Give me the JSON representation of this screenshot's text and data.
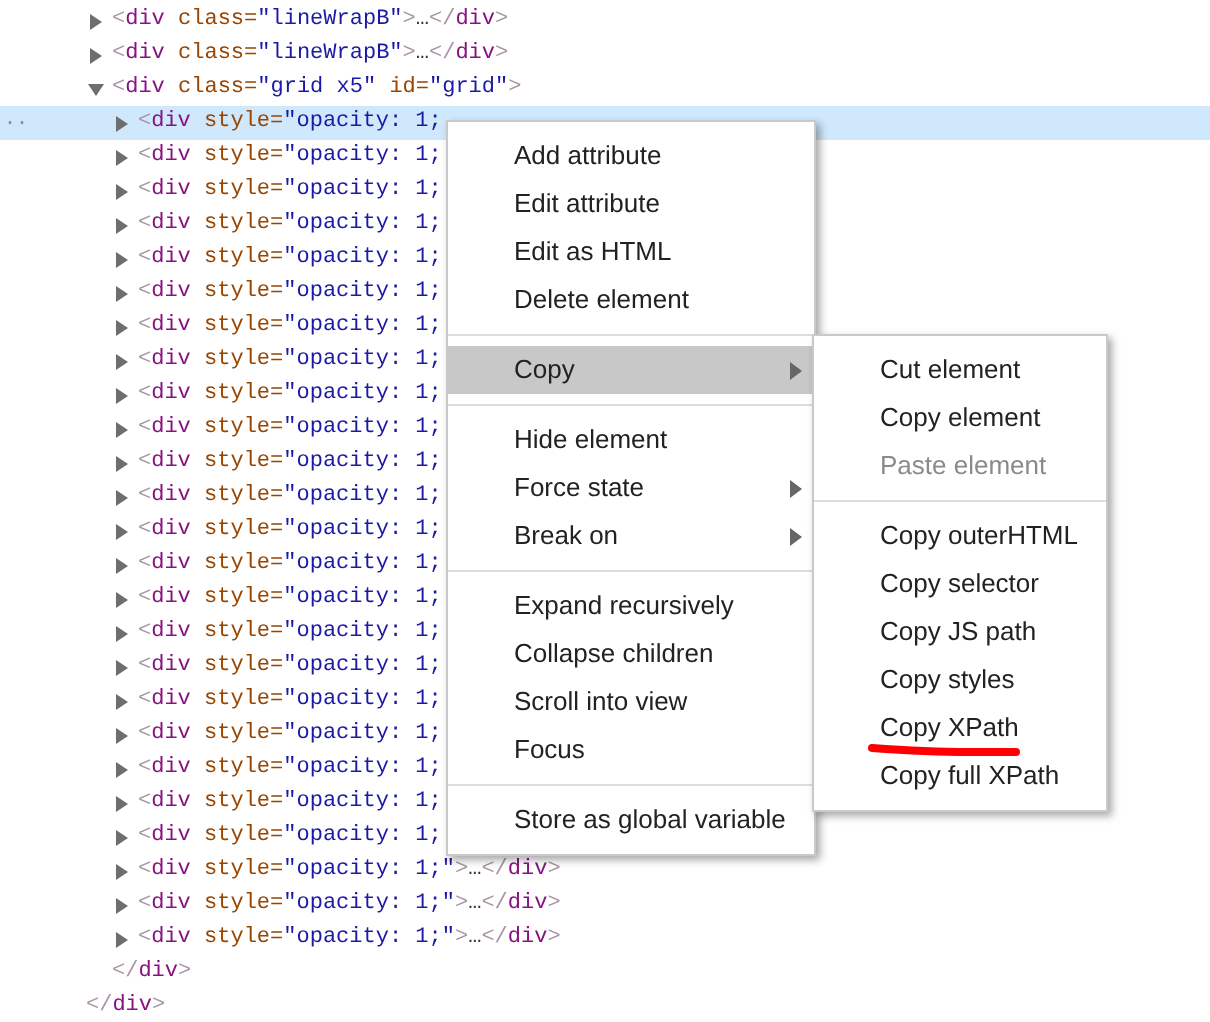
{
  "elements_panel": {
    "nodes": [
      {
        "expanded": false,
        "selected": false,
        "open": "<",
        "tag": "div",
        "attrs": [
          {
            "name": "class",
            "eq": "=",
            "value": "\"lineWrapB\""
          }
        ],
        "close": ">",
        "ellipsis": "…",
        "end_open": "</",
        "end_tag": "div",
        "end_close": ">"
      },
      {
        "expanded": false,
        "selected": false,
        "open": "<",
        "tag": "div",
        "attrs": [
          {
            "name": "class",
            "eq": "=",
            "value": "\"lineWrapB\""
          }
        ],
        "close": ">",
        "ellipsis": "…",
        "end_open": "</",
        "end_tag": "div",
        "end_close": ">"
      },
      {
        "expanded": true,
        "selected": false,
        "open": "<",
        "tag": "div",
        "attrs": [
          {
            "name": "class",
            "eq": "=",
            "value": "\"grid x5\""
          },
          {
            "name": "id",
            "eq": "=",
            "value": "\"grid\""
          }
        ],
        "close": ">",
        "children": [
          {
            "expanded": false,
            "selected": true,
            "lead": "..",
            "open": "<",
            "tag": "div",
            "attrs": [
              {
                "name": "style",
                "eq": "=",
                "value": "\"opacity: 1;"
              }
            ]
          },
          {
            "expanded": false,
            "selected": false,
            "open": "<",
            "tag": "div",
            "attrs": [
              {
                "name": "style",
                "eq": "=",
                "value": "\"opacity: 1;"
              }
            ]
          },
          {
            "expanded": false,
            "selected": false,
            "open": "<",
            "tag": "div",
            "attrs": [
              {
                "name": "style",
                "eq": "=",
                "value": "\"opacity: 1;"
              }
            ]
          },
          {
            "expanded": false,
            "selected": false,
            "open": "<",
            "tag": "div",
            "attrs": [
              {
                "name": "style",
                "eq": "=",
                "value": "\"opacity: 1;"
              }
            ]
          },
          {
            "expanded": false,
            "selected": false,
            "open": "<",
            "tag": "div",
            "attrs": [
              {
                "name": "style",
                "eq": "=",
                "value": "\"opacity: 1;"
              }
            ]
          },
          {
            "expanded": false,
            "selected": false,
            "open": "<",
            "tag": "div",
            "attrs": [
              {
                "name": "style",
                "eq": "=",
                "value": "\"opacity: 1;"
              }
            ]
          },
          {
            "expanded": false,
            "selected": false,
            "open": "<",
            "tag": "div",
            "attrs": [
              {
                "name": "style",
                "eq": "=",
                "value": "\"opacity: 1;"
              }
            ]
          },
          {
            "expanded": false,
            "selected": false,
            "open": "<",
            "tag": "div",
            "attrs": [
              {
                "name": "style",
                "eq": "=",
                "value": "\"opacity: 1;"
              }
            ]
          },
          {
            "expanded": false,
            "selected": false,
            "open": "<",
            "tag": "div",
            "attrs": [
              {
                "name": "style",
                "eq": "=",
                "value": "\"opacity: 1;"
              }
            ]
          },
          {
            "expanded": false,
            "selected": false,
            "open": "<",
            "tag": "div",
            "attrs": [
              {
                "name": "style",
                "eq": "=",
                "value": "\"opacity: 1;"
              }
            ]
          },
          {
            "expanded": false,
            "selected": false,
            "open": "<",
            "tag": "div",
            "attrs": [
              {
                "name": "style",
                "eq": "=",
                "value": "\"opacity: 1;"
              }
            ]
          },
          {
            "expanded": false,
            "selected": false,
            "open": "<",
            "tag": "div",
            "attrs": [
              {
                "name": "style",
                "eq": "=",
                "value": "\"opacity: 1;"
              }
            ]
          },
          {
            "expanded": false,
            "selected": false,
            "open": "<",
            "tag": "div",
            "attrs": [
              {
                "name": "style",
                "eq": "=",
                "value": "\"opacity: 1;"
              }
            ]
          },
          {
            "expanded": false,
            "selected": false,
            "open": "<",
            "tag": "div",
            "attrs": [
              {
                "name": "style",
                "eq": "=",
                "value": "\"opacity: 1;"
              }
            ]
          },
          {
            "expanded": false,
            "selected": false,
            "open": "<",
            "tag": "div",
            "attrs": [
              {
                "name": "style",
                "eq": "=",
                "value": "\"opacity: 1;"
              }
            ]
          },
          {
            "expanded": false,
            "selected": false,
            "open": "<",
            "tag": "div",
            "attrs": [
              {
                "name": "style",
                "eq": "=",
                "value": "\"opacity: 1;"
              }
            ]
          },
          {
            "expanded": false,
            "selected": false,
            "open": "<",
            "tag": "div",
            "attrs": [
              {
                "name": "style",
                "eq": "=",
                "value": "\"opacity: 1;"
              }
            ]
          },
          {
            "expanded": false,
            "selected": false,
            "open": "<",
            "tag": "div",
            "attrs": [
              {
                "name": "style",
                "eq": "=",
                "value": "\"opacity: 1;"
              }
            ]
          },
          {
            "expanded": false,
            "selected": false,
            "open": "<",
            "tag": "div",
            "attrs": [
              {
                "name": "style",
                "eq": "=",
                "value": "\"opacity: 1;"
              }
            ]
          },
          {
            "expanded": false,
            "selected": false,
            "open": "<",
            "tag": "div",
            "attrs": [
              {
                "name": "style",
                "eq": "=",
                "value": "\"opacity: 1;"
              }
            ]
          },
          {
            "expanded": false,
            "selected": false,
            "open": "<",
            "tag": "div",
            "attrs": [
              {
                "name": "style",
                "eq": "=",
                "value": "\"opacity: 1;"
              }
            ]
          },
          {
            "expanded": false,
            "selected": false,
            "open": "<",
            "tag": "div",
            "attrs": [
              {
                "name": "style",
                "eq": "=",
                "value": "\"opacity: 1;"
              }
            ]
          },
          {
            "expanded": false,
            "selected": false,
            "open": "<",
            "tag": "div",
            "attrs": [
              {
                "name": "style",
                "eq": "=",
                "value": "\"opacity: 1;\""
              }
            ],
            "close": ">",
            "ellipsis": "…",
            "end_open": "</",
            "end_tag": "div",
            "end_close": ">"
          },
          {
            "expanded": false,
            "selected": false,
            "open": "<",
            "tag": "div",
            "attrs": [
              {
                "name": "style",
                "eq": "=",
                "value": "\"opacity: 1;\""
              }
            ],
            "close": ">",
            "ellipsis": "…",
            "end_open": "</",
            "end_tag": "div",
            "end_close": ">"
          },
          {
            "expanded": false,
            "selected": false,
            "open": "<",
            "tag": "div",
            "attrs": [
              {
                "name": "style",
                "eq": "=",
                "value": "\"opacity: 1;\""
              }
            ],
            "close": ">",
            "ellipsis": "…",
            "end_open": "</",
            "end_tag": "div",
            "end_close": ">"
          }
        ],
        "closing": {
          "end_open": "</",
          "end_tag": "div",
          "end_close": ">"
        }
      }
    ],
    "closing": {
      "end_open": "</",
      "end_tag": "div",
      "end_close": ">"
    }
  },
  "context_menu": {
    "items": [
      {
        "kind": "item",
        "label": "Add attribute",
        "selected": false,
        "submenu": false,
        "disabled": false
      },
      {
        "kind": "item",
        "label": "Edit attribute",
        "selected": false,
        "submenu": false,
        "disabled": false
      },
      {
        "kind": "item",
        "label": "Edit as HTML",
        "selected": false,
        "submenu": false,
        "disabled": false
      },
      {
        "kind": "item",
        "label": "Delete element",
        "selected": false,
        "submenu": false,
        "disabled": false
      },
      {
        "kind": "separator"
      },
      {
        "kind": "item",
        "label": "Copy",
        "selected": true,
        "submenu": true,
        "disabled": false
      },
      {
        "kind": "separator"
      },
      {
        "kind": "item",
        "label": "Hide element",
        "selected": false,
        "submenu": false,
        "disabled": false
      },
      {
        "kind": "item",
        "label": "Force state",
        "selected": false,
        "submenu": true,
        "disabled": false
      },
      {
        "kind": "item",
        "label": "Break on",
        "selected": false,
        "submenu": true,
        "disabled": false
      },
      {
        "kind": "separator"
      },
      {
        "kind": "item",
        "label": "Expand recursively",
        "selected": false,
        "submenu": false,
        "disabled": false
      },
      {
        "kind": "item",
        "label": "Collapse children",
        "selected": false,
        "submenu": false,
        "disabled": false
      },
      {
        "kind": "item",
        "label": "Scroll into view",
        "selected": false,
        "submenu": false,
        "disabled": false
      },
      {
        "kind": "item",
        "label": "Focus",
        "selected": false,
        "submenu": false,
        "disabled": false
      },
      {
        "kind": "separator"
      },
      {
        "kind": "item",
        "label": "Store as global variable",
        "selected": false,
        "submenu": false,
        "disabled": false
      }
    ]
  },
  "copy_submenu": {
    "items": [
      {
        "kind": "item",
        "label": "Cut element",
        "selected": false,
        "submenu": false,
        "disabled": false
      },
      {
        "kind": "item",
        "label": "Copy element",
        "selected": false,
        "submenu": false,
        "disabled": false
      },
      {
        "kind": "item",
        "label": "Paste element",
        "selected": false,
        "submenu": false,
        "disabled": true
      },
      {
        "kind": "separator"
      },
      {
        "kind": "item",
        "label": "Copy outerHTML",
        "selected": false,
        "submenu": false,
        "disabled": false
      },
      {
        "kind": "item",
        "label": "Copy selector",
        "selected": false,
        "submenu": false,
        "disabled": false
      },
      {
        "kind": "item",
        "label": "Copy JS path",
        "selected": false,
        "submenu": false,
        "disabled": false
      },
      {
        "kind": "item",
        "label": "Copy styles",
        "selected": false,
        "submenu": false,
        "disabled": false
      },
      {
        "kind": "item",
        "label": "Copy XPath",
        "selected": false,
        "submenu": false,
        "disabled": false,
        "underlined": true
      },
      {
        "kind": "item",
        "label": "Copy full XPath",
        "selected": false,
        "submenu": false,
        "disabled": false
      }
    ]
  }
}
